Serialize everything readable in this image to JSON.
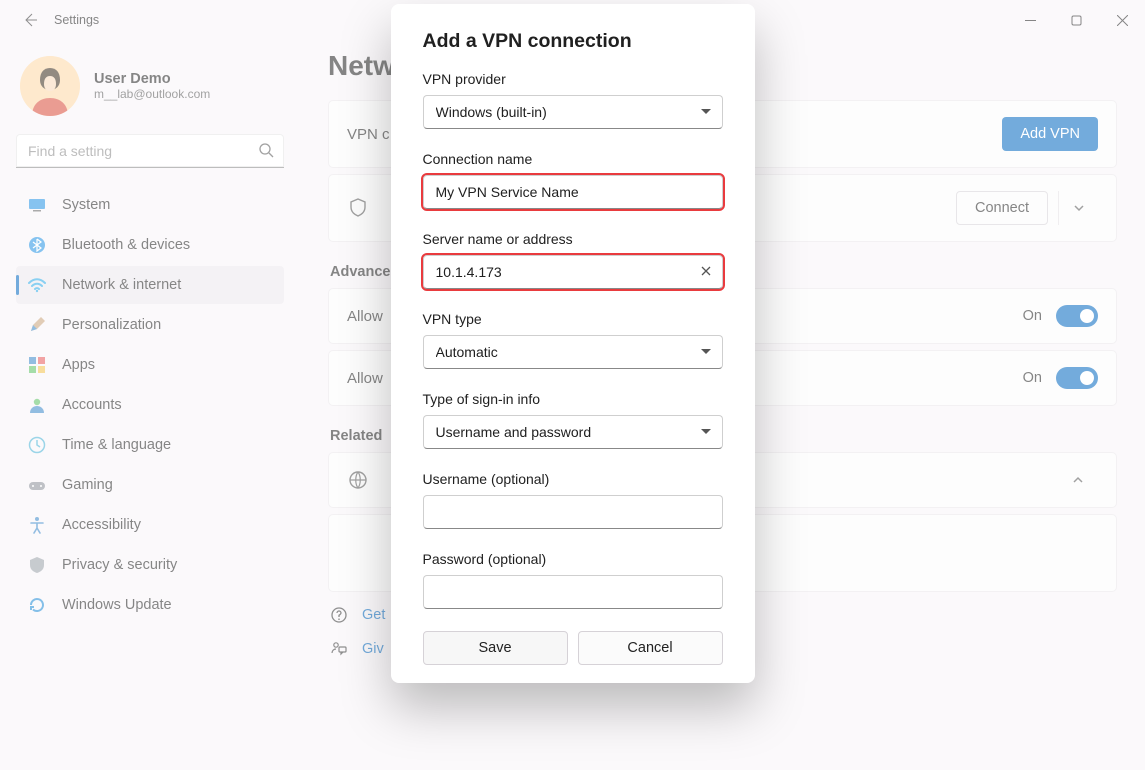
{
  "titlebar": {
    "title": "Settings"
  },
  "user": {
    "name": "User Demo",
    "email": "m__lab@outlook.com"
  },
  "search": {
    "placeholder": "Find a setting"
  },
  "nav": {
    "items": [
      {
        "label": "System"
      },
      {
        "label": "Bluetooth & devices"
      },
      {
        "label": "Network & internet"
      },
      {
        "label": "Personalization"
      },
      {
        "label": "Apps"
      },
      {
        "label": "Accounts"
      },
      {
        "label": "Time & language"
      },
      {
        "label": "Gaming"
      },
      {
        "label": "Accessibility"
      },
      {
        "label": "Privacy & security"
      },
      {
        "label": "Windows Update"
      }
    ]
  },
  "main": {
    "title_truncated": "Netw",
    "vpn_row_truncated": "VPN c",
    "add_vpn": "Add VPN",
    "connect": "Connect",
    "advanced_truncated": "Advanced",
    "allow1_truncated": "Allow",
    "allow2_truncated": "Allow",
    "on": "On",
    "related_truncated": "Related",
    "get_truncated": "Get",
    "give_truncated": "Giv"
  },
  "modal": {
    "title": "Add a VPN connection",
    "provider_label": "VPN provider",
    "provider_value": "Windows (built-in)",
    "conn_label": "Connection name",
    "conn_value": "My VPN Service Name",
    "server_label": "Server name or address",
    "server_value": "10.1.4.173",
    "type_label": "VPN type",
    "type_value": "Automatic",
    "signin_label": "Type of sign-in info",
    "signin_value": "Username and password",
    "user_label": "Username (optional)",
    "pass_label": "Password (optional)",
    "save": "Save",
    "cancel": "Cancel"
  }
}
